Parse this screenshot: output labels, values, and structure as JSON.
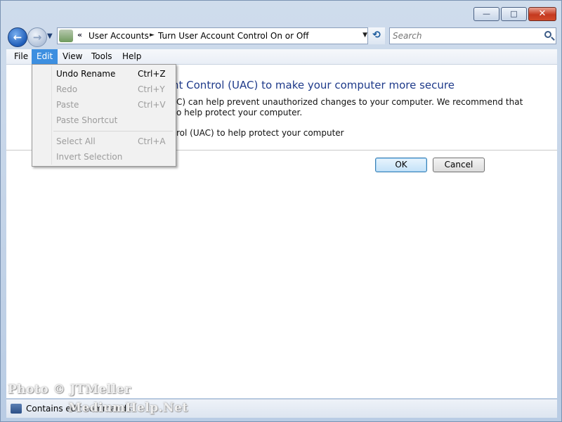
{
  "window": {
    "minimize": "—",
    "maximize": "□",
    "close": "✕"
  },
  "nav": {
    "back_glyph": "←",
    "forward_glyph": "→",
    "history_dropdown_glyph": "▼"
  },
  "address": {
    "chevron": "«",
    "crumbs": [
      "User Accounts",
      "Turn User Account Control On or Off"
    ],
    "arrow": "►",
    "dropdown_glyph": "▼",
    "refresh_glyph": "⟲"
  },
  "search": {
    "placeholder": "Search"
  },
  "menu": {
    "items": [
      "File",
      "Edit",
      "View",
      "Tools",
      "Help"
    ],
    "active": "Edit"
  },
  "edit_menu": {
    "items": [
      {
        "label": "Undo Rename",
        "shortcut": "Ctrl+Z",
        "enabled": true
      },
      {
        "label": "Redo",
        "shortcut": "Ctrl+Y",
        "enabled": false
      },
      {
        "label": "Paste",
        "shortcut": "Ctrl+V",
        "enabled": false
      },
      {
        "label": "Paste Shortcut",
        "shortcut": "",
        "enabled": false
      },
      {
        "label": "Select All",
        "shortcut": "Ctrl+A",
        "enabled": false
      },
      {
        "label": "Invert Selection",
        "shortcut": "",
        "enabled": false
      }
    ]
  },
  "content": {
    "heading_visible": "nt Control (UAC) to make your computer more secure",
    "desc_line1": "C) can help prevent unauthorized changes to your computer.  We recommend that",
    "desc_line2": "o help protect your computer.",
    "option_label": "rol (UAC) to help protect your computer"
  },
  "buttons": {
    "ok": "OK",
    "cancel": "Cancel"
  },
  "watermark": {
    "line1": "Photo © JTMeller",
    "line2": "MediumHelp.Net"
  },
  "status_bar": {
    "text": "Contains edit commands."
  }
}
